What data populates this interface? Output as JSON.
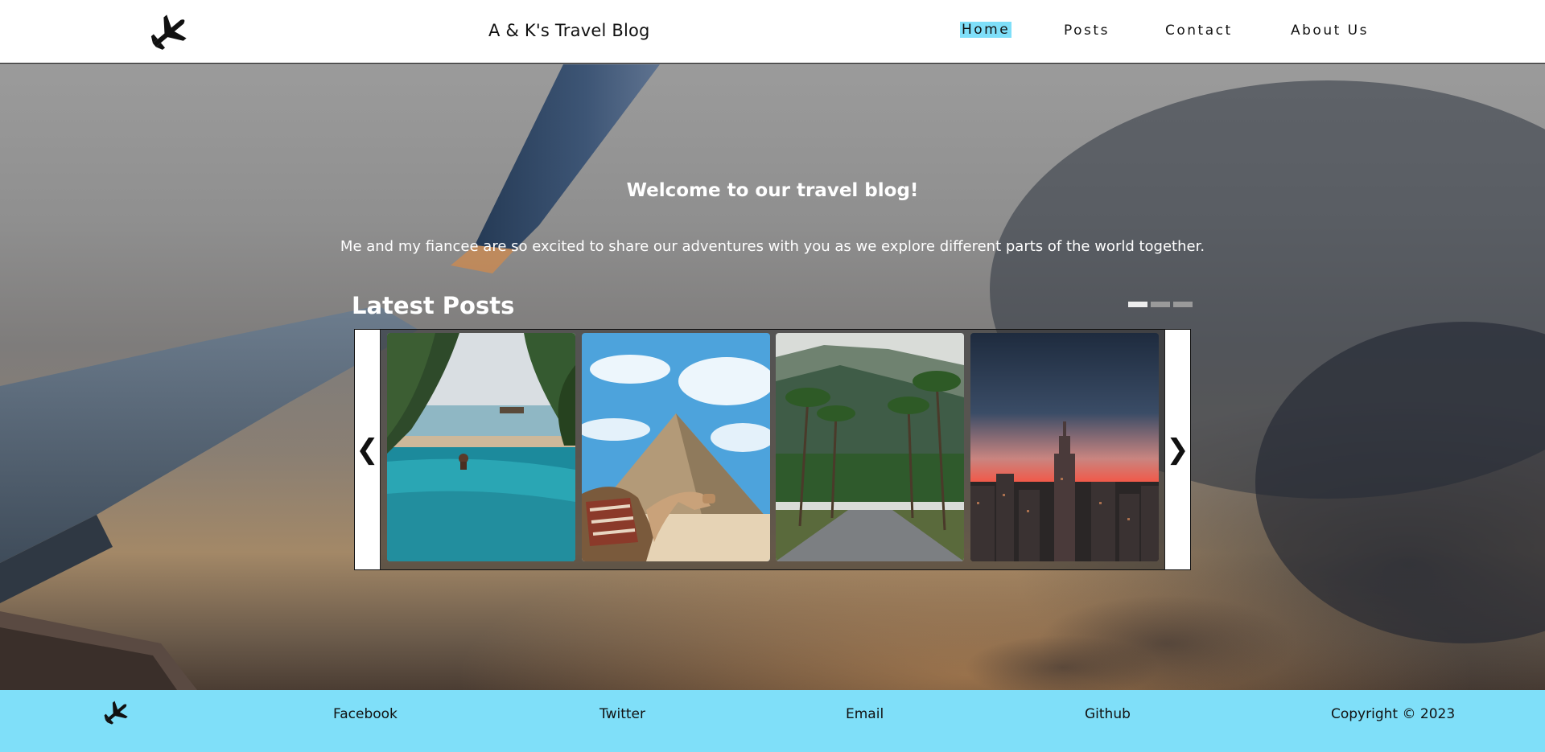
{
  "header": {
    "logo_icon": "airplane-icon",
    "title": "A & K's Travel Blog",
    "nav": {
      "home": "Home",
      "posts": "Posts",
      "contact": "Contact",
      "about": "About Us"
    },
    "active_nav": "Home",
    "active_color": "#7fdff9"
  },
  "hero": {
    "welcome": "Welcome to our travel blog!",
    "intro": "Me and my fiancee are so excited to share our adventures with you as we explore different parts of the world together.",
    "latest_heading": "Latest Posts",
    "slide_indicators": {
      "count": 3,
      "active": 1
    }
  },
  "carousel": {
    "prev_label": "❮",
    "next_label": "❯",
    "cards": [
      {
        "image": "infinity-pool-beach-photo"
      },
      {
        "image": "pyramid-camel-photo"
      },
      {
        "image": "palm-road-mountains-photo"
      },
      {
        "image": "city-skyline-sunset-photo"
      }
    ]
  },
  "footer": {
    "logo_icon": "airplane-icon",
    "facebook": "Facebook",
    "twitter": "Twitter",
    "email": "Email",
    "github": "Github",
    "copyright": "Copyright © 2023",
    "background_color": "#7fdff9"
  }
}
